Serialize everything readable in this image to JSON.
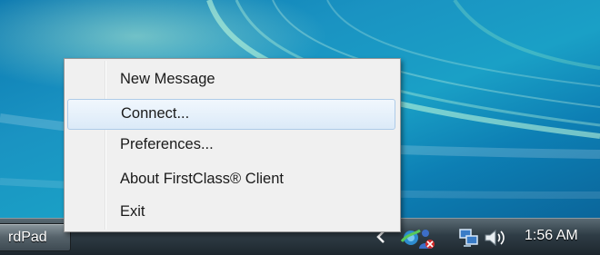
{
  "taskbar": {
    "active_window_label": "rdPad",
    "clock": "1:56 AM"
  },
  "tray_icons": [
    "show-hidden-icons-chevron-icon",
    "firstclass-client-icon",
    "network-icon",
    "volume-icon"
  ],
  "context_menu": {
    "items": [
      {
        "label": "New Message",
        "highlighted": false
      },
      {
        "label": "Connect...",
        "highlighted": true
      },
      {
        "label": "Preferences...",
        "highlighted": false
      },
      {
        "label": "About FirstClass® Client",
        "highlighted": false
      },
      {
        "label": "Exit",
        "highlighted": false
      }
    ]
  },
  "colors": {
    "desktop": "#1a93c2",
    "taskbar": "#2f3d46",
    "menu_background": "#f0f0f0",
    "menu_highlight": "#dbeaf8"
  }
}
